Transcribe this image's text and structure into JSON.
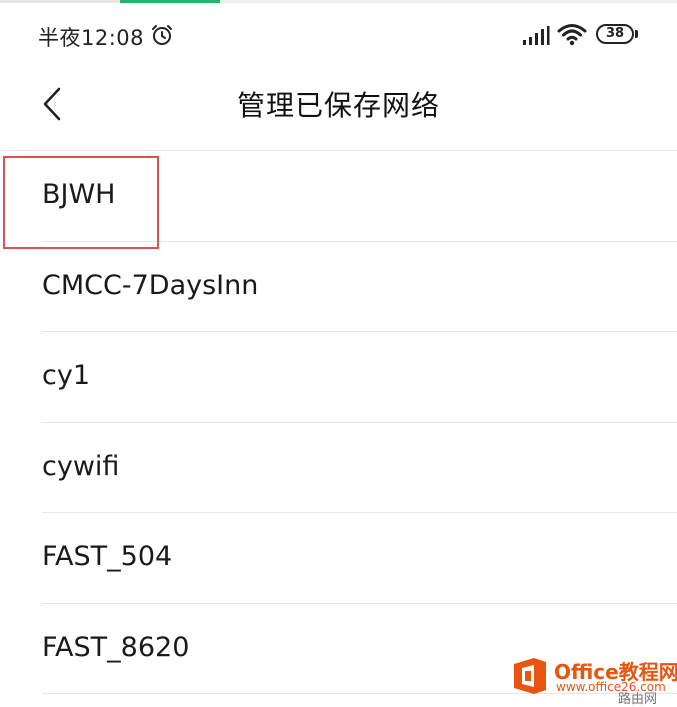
{
  "status_bar": {
    "time": "半夜12:08",
    "battery_level": "38",
    "icons": [
      "alarm-icon",
      "signal-icon",
      "wifi-icon",
      "battery-icon"
    ]
  },
  "header": {
    "title": "管理已保存网络",
    "back_icon": "chevron-left-icon"
  },
  "networks": [
    {
      "label": "BJWH"
    },
    {
      "label": "CMCC-7DaysInn"
    },
    {
      "label": "cy1"
    },
    {
      "label": "cywifi"
    },
    {
      "label": "FAST_504"
    },
    {
      "label": "FAST_8620"
    }
  ],
  "highlight": {
    "color": "#d9534f"
  },
  "watermark": {
    "title": "Office教程网",
    "url": "www.office26.com",
    "extra": "路由网",
    "color": "#e8550e"
  }
}
